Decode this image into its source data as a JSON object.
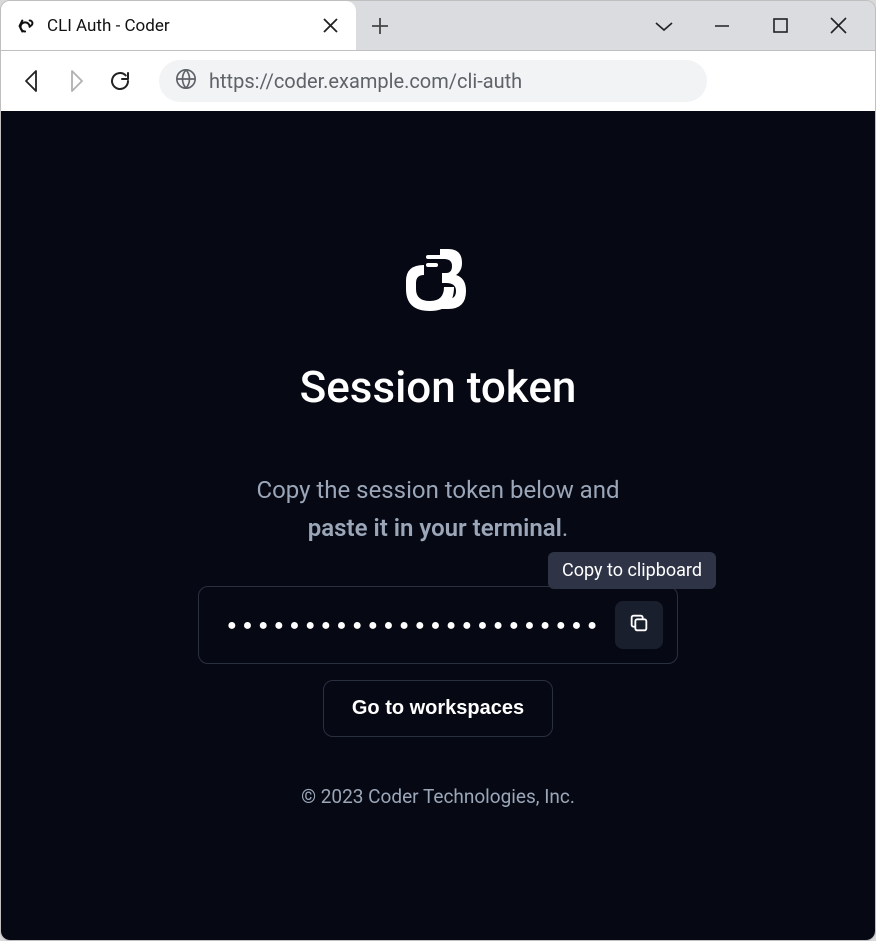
{
  "browser": {
    "tab_title": "CLI Auth - Coder",
    "url": "https://coder.example.com/cli-auth"
  },
  "page": {
    "heading": "Session token",
    "subtext_line1": "Copy the session token below and",
    "subtext_line2_strong": "paste it in your terminal",
    "subtext_line2_suffix": ".",
    "tooltip": "Copy to clipboard",
    "token_masked": "●●●●●●●●●●●●●●●●●●●●●●●●●●●●●●",
    "workspaces_button": "Go to workspaces",
    "footer": "© 2023 Coder Technologies, Inc."
  }
}
